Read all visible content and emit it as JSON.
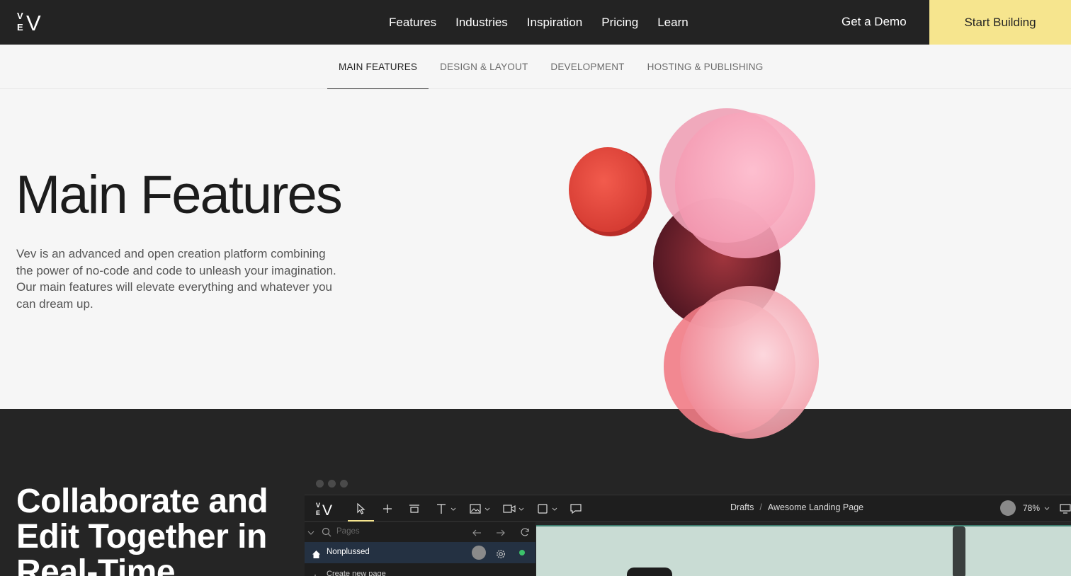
{
  "nav": {
    "logo_letters": {
      "top": "V",
      "bottom": "E",
      "big": "V"
    },
    "links": [
      "Features",
      "Industries",
      "Inspiration",
      "Pricing",
      "Learn"
    ],
    "demo": "Get a Demo",
    "start": "Start Building"
  },
  "subnav": {
    "tabs": [
      "MAIN FEATURES",
      "DESIGN & LAYOUT",
      "DEVELOPMENT",
      "HOSTING & PUBLISHING"
    ],
    "active": 0
  },
  "hero": {
    "title": "Main Features",
    "description": "Vev is an advanced and open creation platform combining the power of no-code and code to unleash your imagination. Our main features will elevate everything and whatever you can dream up."
  },
  "collab": {
    "title": "Collaborate and Edit Together in Real-Time"
  },
  "editor": {
    "breadcrumb": [
      "Drafts",
      "Awesome Landing Page"
    ],
    "zoom": "78%",
    "search_placeholder": "Pages",
    "page_name": "Nonplussed",
    "new_page": "Create new page"
  },
  "colors": {
    "topbar": "#232323",
    "cta": "#f6e58e",
    "dark_section": "#252525",
    "status_online": "#3cc26b"
  },
  "icons": [
    "logo-icon",
    "cursor-icon",
    "plus-icon",
    "frame-icon",
    "text-icon",
    "image-icon",
    "video-icon",
    "shape-icon",
    "comment-icon",
    "search-icon",
    "arrow-left-icon",
    "arrow-right-icon",
    "refresh-icon",
    "home-icon",
    "gear-icon",
    "chevron-down-icon",
    "desktop-icon"
  ]
}
